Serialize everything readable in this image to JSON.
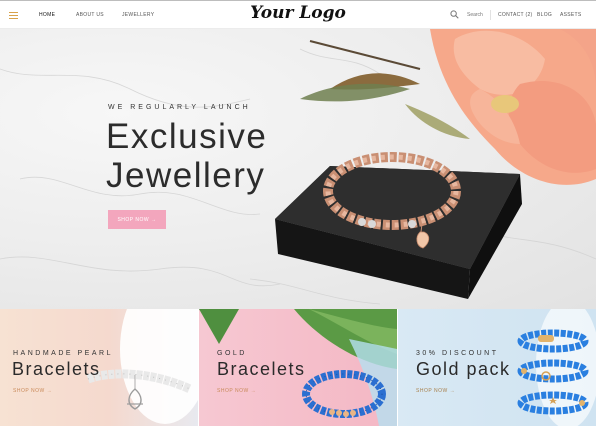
{
  "header": {
    "menu_icon": "hamburger-icon",
    "nav_left": [
      {
        "label": "HOME",
        "active": true
      },
      {
        "label": "ABOUT US",
        "active": false
      },
      {
        "label": "JEWELLERY",
        "active": false
      }
    ],
    "logo": "Your Logo",
    "search_icon": "search-icon",
    "search_label": "Search",
    "nav_right": [
      {
        "label": "CONTACT (2)"
      },
      {
        "label": "BLOG"
      },
      {
        "label": "ASSETS"
      }
    ],
    "accent_color": "#d8a24a"
  },
  "hero": {
    "eyebrow": "WE REGULARLY LAUNCH",
    "title_line1": "Exclusive",
    "title_line2": "Jewellery",
    "button_label": "SHOP NOW →",
    "button_color": "#f3a6bd"
  },
  "tiles": [
    {
      "eyebrow": "HANDMADE PEARL",
      "title": "Bracelets",
      "link": "SHOP NOW →"
    },
    {
      "eyebrow": "GOLD",
      "title": "Bracelets",
      "link": "SHOP NOW →"
    },
    {
      "eyebrow": "30% DISCOUNT",
      "title": "Gold pack",
      "link": "SHOP NOW →"
    }
  ]
}
